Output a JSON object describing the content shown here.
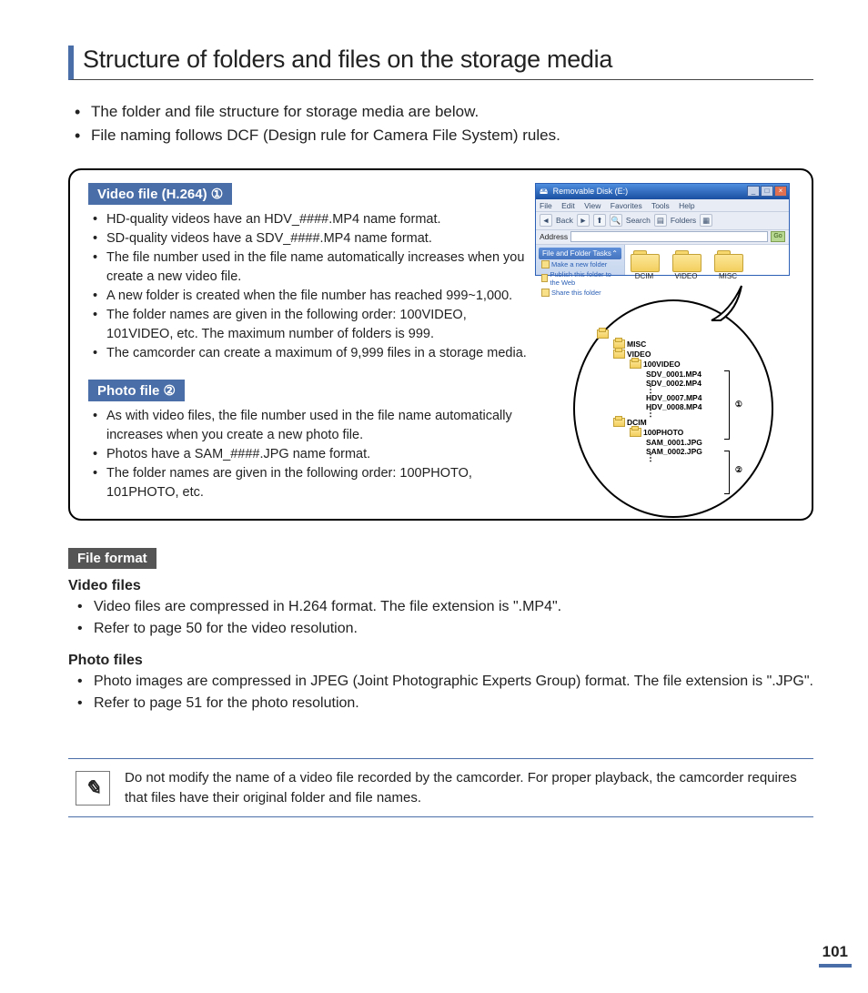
{
  "title": "Structure of folders and files on the storage media",
  "top_bullets": [
    "The folder and file structure for storage media are below.",
    "File naming follows DCF (Design rule for Camera File System) rules."
  ],
  "video_section": {
    "heading": "Video file (H.264) ①",
    "items": [
      "HD-quality videos have an HDV_####.MP4 name format.",
      "SD-quality videos have a SDV_####.MP4 name format.",
      "The file number used in the file name automatically increases when you create a new video file.",
      "A new folder is created when the file number has reached 999~1,000.",
      "The folder names are given in the following order: 100VIDEO, 101VIDEO, etc. The maximum number of folders is 999.",
      "The camcorder can create a maximum of 9,999 files in a storage media."
    ]
  },
  "photo_section": {
    "heading": "Photo file ②",
    "items": [
      "As with video files, the file number used in the file name automatically increases when you create a new photo file.",
      "Photos have a SAM_####.JPG name format.",
      "The folder names are given in the following order: 100PHOTO, 101PHOTO, etc."
    ]
  },
  "file_format": {
    "heading": "File format",
    "video": {
      "heading": "Video files",
      "items": [
        "Video files are compressed in H.264 format. The file extension is \".MP4\".",
        "Refer to page 50 for the video resolution."
      ]
    },
    "photo": {
      "heading": "Photo files",
      "items": [
        "Photo images are compressed in JPEG (Joint Photographic Experts Group) format. The file extension is \".JPG\".",
        "Refer to page 51 for the photo resolution."
      ]
    }
  },
  "note": "Do not modify the name of a video file recorded by the camcorder. For proper playback, the camcorder requires that files have their original folder and file names.",
  "page_number": "101",
  "explorer": {
    "title": "Removable Disk (E:)",
    "menus": [
      "File",
      "Edit",
      "View",
      "Favorites",
      "Tools",
      "Help"
    ],
    "toolbar": {
      "back": "Back",
      "search": "Search",
      "folders": "Folders"
    },
    "go": "Go",
    "task_head": "File and Folder Tasks",
    "task_items": [
      "Make a new folder",
      "Publish this folder to the Web",
      "Share this folder"
    ],
    "root_folders": [
      "DCIM",
      "VIDEO",
      "MISC"
    ]
  },
  "tree": {
    "l1": "MISC",
    "l2": "VIDEO",
    "l3": "100VIDEO",
    "f1": "SDV_0001.MP4",
    "f2": "SDV_0002.MP4",
    "f3": "HDV_0007.MP4",
    "f4": "HDV_0008.MP4",
    "l4": "DCIM",
    "l5": "100PHOTO",
    "f5": "SAM_0001.JPG",
    "f6": "SAM_0002.JPG",
    "label1": "①",
    "label2": "②"
  }
}
